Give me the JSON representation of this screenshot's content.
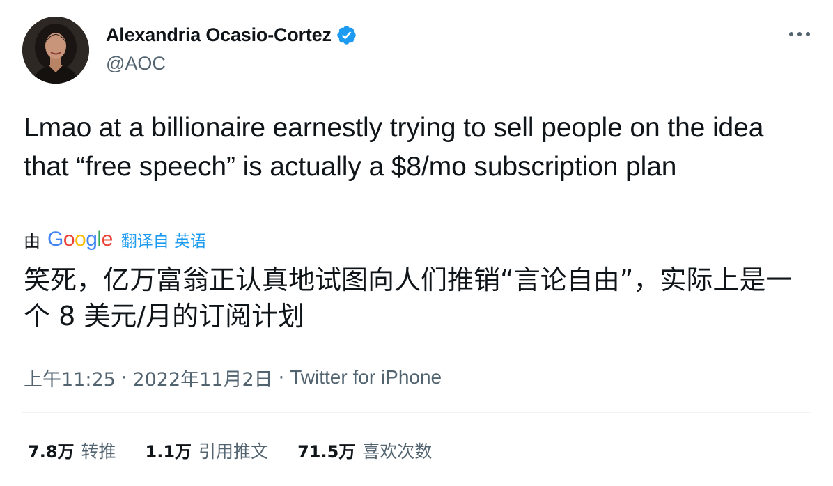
{
  "author": {
    "display_name": "Alexandria Ocasio-Cortez",
    "handle": "@AOC",
    "verified_icon": "verified-badge-icon",
    "avatar_icon": "avatar"
  },
  "menu": {
    "more_icon": "more-horizontal-icon"
  },
  "tweet": {
    "text": "Lmao at a billionaire earnestly trying to sell people on the idea that “free speech” is actually a $8/mo subscription plan",
    "translation": {
      "by_label": "由",
      "provider": "Google",
      "link_label": "翻译自 英语",
      "text": "笑死，亿万富翁正认真地试图向人们推销“言论自由”，实际上是一个 8 美元/月的订阅计划"
    }
  },
  "meta": {
    "time": "上午11:25",
    "date": "2022年11月2日",
    "separator": "·",
    "source": "Twitter for iPhone"
  },
  "stats": [
    {
      "value": "7.8万",
      "label": "转推"
    },
    {
      "value": "1.1万",
      "label": "引用推文"
    },
    {
      "value": "71.5万",
      "label": "喜欢次数"
    }
  ],
  "colors": {
    "text_primary": "#0f1419",
    "text_secondary": "#536471",
    "link_blue": "#1d9bf0",
    "verified_blue": "#1d9bf0",
    "divider": "#eff3f4",
    "google_blue": "#4285f4",
    "google_red": "#ea4335",
    "google_yellow": "#fbbc05",
    "google_green": "#34a853"
  }
}
